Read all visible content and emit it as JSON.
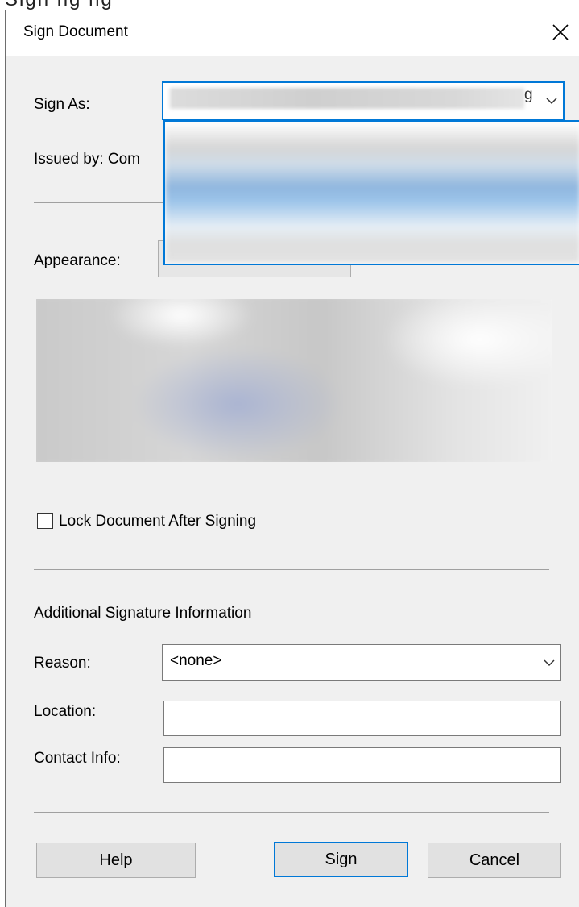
{
  "window": {
    "title": "Sign Document"
  },
  "sign_as": {
    "label": "Sign As:",
    "value_clip": "g"
  },
  "issued_by": {
    "label": "Issued by: Com"
  },
  "appearance": {
    "label": "Appearance:"
  },
  "options": {
    "lock_label": "Lock Document After Signing",
    "lock_checked": false
  },
  "additional": {
    "heading": "Additional Signature Information",
    "reason_label": "Reason:",
    "reason_value": "<none>",
    "location_label": "Location:",
    "location_value": "",
    "contact_label": "Contact Info:",
    "contact_value": ""
  },
  "buttons": {
    "help": "Help",
    "sign": "Sign",
    "cancel": "Cancel"
  },
  "icons": {
    "close": "close-icon",
    "dropdown": "chevron-down-icon"
  },
  "colors": {
    "accent": "#0078d7",
    "dialog_bg": "#f0f0f0",
    "button_bg": "#e1e1e1"
  }
}
